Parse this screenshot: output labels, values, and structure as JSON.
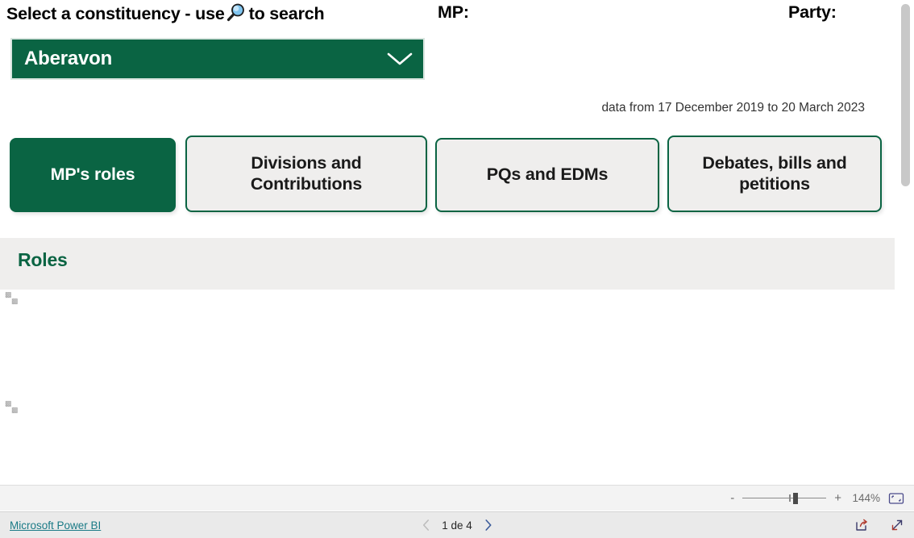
{
  "header": {
    "select_label_pre": "Select a constituency -  use",
    "select_label_post": "to search",
    "search_icon": "magnifier-icon",
    "mp_label": "MP:",
    "party_label": "Party:"
  },
  "slicer": {
    "name": "constituency-slicer",
    "value": "Aberavon",
    "chevron_icon": "chevron-down-icon"
  },
  "caption": {
    "data_range": "data from 17 December 2019 to 20 March 2023"
  },
  "tabs": [
    {
      "label": "MP's roles",
      "active": true
    },
    {
      "label": "Divisions and Contributions",
      "active": false
    },
    {
      "label": "PQs and EDMs",
      "active": false
    },
    {
      "label": "Debates, bills and petitions",
      "active": false
    }
  ],
  "section": {
    "roles_title": "Roles"
  },
  "statusbar": {
    "zoom_out_label": "-",
    "zoom_in_label": "+",
    "zoom_percent": "144%",
    "fit_icon": "fit-to-page-icon"
  },
  "bottombar": {
    "powerbi_link": "Microsoft Power BI",
    "prev_icon": "chevron-left-icon",
    "next_icon": "chevron-right-icon",
    "page_text": "1 de 4",
    "share_icon": "share-export-icon",
    "fullscreen_icon": "fullscreen-icon"
  },
  "colors": {
    "brand_green": "#0a6443",
    "panel_grey": "#efeeed",
    "link_teal": "#1a7a86"
  }
}
